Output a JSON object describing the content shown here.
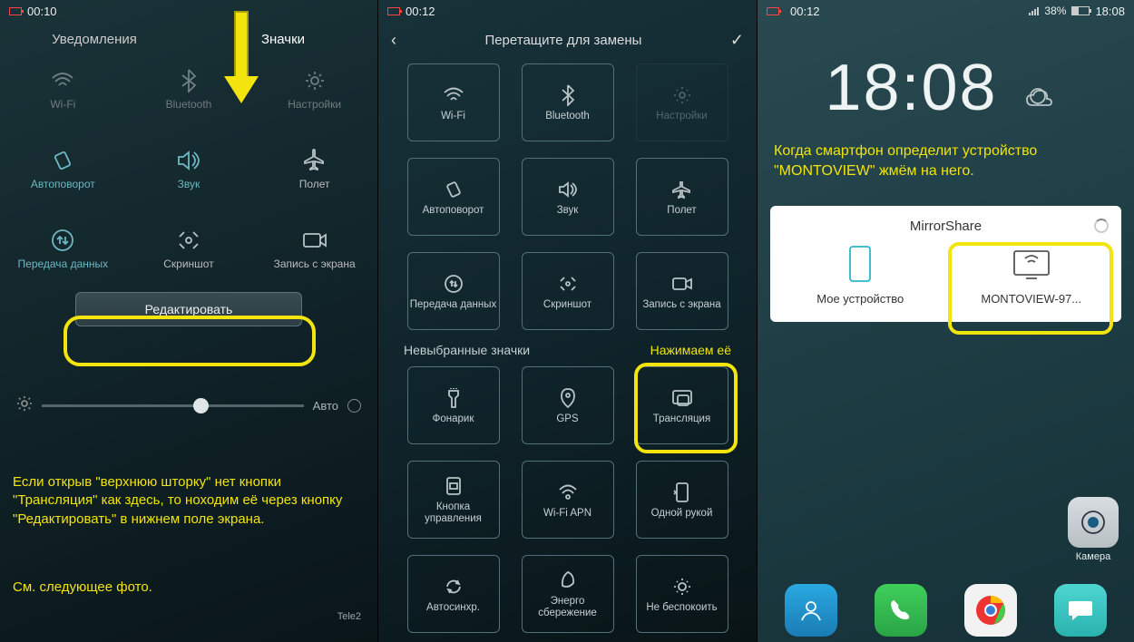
{
  "p1": {
    "time": "00:10",
    "tab_notify": "Уведомления",
    "tab_icons": "Значки",
    "row1": {
      "wifi": "Wi-Fi",
      "bt": "Bluetooth",
      "settings": "Настройки"
    },
    "row2": {
      "rotate": "Автоповорот",
      "sound": "Звук",
      "flight": "Полет"
    },
    "row3": {
      "data": "Передача данных",
      "shot": "Скриншот",
      "rec": "Запись с экрана"
    },
    "edit": "Редактировать",
    "auto": "Авто",
    "caption1": "Если открыв \"верхнюю шторку\" нет кнопки \"Трансляция\" как здесь, то ноходим её через кнопку \"Редактировать\" в нижнем поле экрана.",
    "caption2": "См. следующее фото.",
    "carrier": "Tele2"
  },
  "p2": {
    "time": "00:12",
    "title": "Перетащите для замены",
    "tiles": {
      "wifi": "Wi-Fi",
      "bt": "Bluetooth",
      "settings": "Настройки",
      "rotate": "Автоповорот",
      "sound": "Звук",
      "flight": "Полет",
      "data": "Передача данных",
      "shot": "Скриншот",
      "rec": "Запись с экрана",
      "torch": "Фонарик",
      "gps": "GPS",
      "cast": "Трансляция",
      "ctrl": "Кнопка управления",
      "apn": "Wi-Fi APN",
      "one": "Одной рукой",
      "sync": "Автосинхр.",
      "eco": "Энерго сбережение",
      "dnd": "Не беспокоить"
    },
    "unselected": "Невыбранные значки",
    "hint": "Нажимаем её"
  },
  "p3": {
    "time_top": "00:12",
    "pct": "38%",
    "time_right": "18:08",
    "clock": "18:08",
    "caption": "Когда смартфон определит устройство \"MONTOVIEW\" жмём на него.",
    "card_title": "MirrorShare",
    "dev_my": "Мое устройство",
    "dev_cast": "MONTOVIEW-97...",
    "app_camera": "Камера"
  }
}
